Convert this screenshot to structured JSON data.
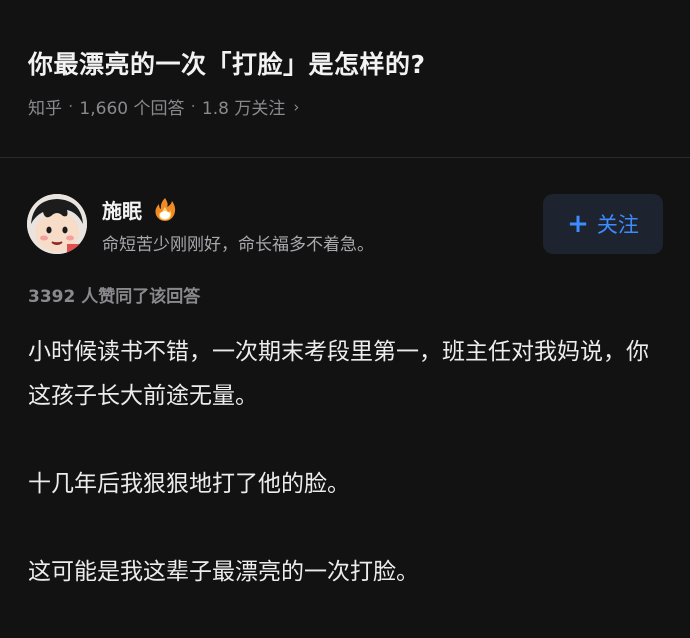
{
  "question": {
    "title": "你最漂亮的一次「打脸」是怎样的?",
    "source": "知乎",
    "separator": "·",
    "answers": "1,660 个回答",
    "followers": "1.8 万关注",
    "chevron": "›"
  },
  "author": {
    "name": "施眠",
    "badge_icon": "flame-badge-icon",
    "bio": "命短苦少刚刚好，命长福多不着急。",
    "follow_plus": "+",
    "follow_label": "关注"
  },
  "answer": {
    "votes": "3392 人赞同了该回答",
    "paragraphs": [
      "小时候读书不错，一次期末考段里第一，班主任对我妈说，你这孩子长大前途无量。",
      "十几年后我狠狠地打了他的脸。",
      "这可能是我这辈子最漂亮的一次打脸。"
    ]
  },
  "colors": {
    "background": "#121212",
    "accent": "#3d8bff",
    "follow_bg": "#1d2430"
  }
}
